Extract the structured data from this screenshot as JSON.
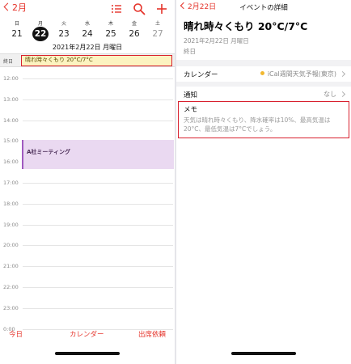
{
  "left": {
    "back_label": "2月",
    "weekdays": [
      "日",
      "月",
      "火",
      "水",
      "木",
      "金",
      "土"
    ],
    "dates": [
      {
        "label": "21",
        "state": "normal"
      },
      {
        "label": "22",
        "state": "selected"
      },
      {
        "label": "23",
        "state": "normal"
      },
      {
        "label": "24",
        "state": "normal"
      },
      {
        "label": "25",
        "state": "normal"
      },
      {
        "label": "26",
        "state": "normal"
      },
      {
        "label": "27",
        "state": "dim"
      }
    ],
    "full_date": "2021年2月22日 月曜日",
    "allday_label": "終日",
    "allday_event": "晴れ時々くもり 20°C/7°C",
    "hours": [
      "12:00",
      "13:00",
      "14:00",
      "15:00",
      "16:00",
      "17:00",
      "18:00",
      "19:00",
      "20:00",
      "21:00",
      "22:00",
      "23:00",
      "0:00"
    ],
    "meeting_title": "A社ミーティング",
    "tabs": {
      "today": "今日",
      "calendars": "カレンダー",
      "inbox": "出席依頼"
    },
    "icons": [
      "list-icon",
      "search-icon",
      "add-icon"
    ],
    "accent_color": "#e5332a"
  },
  "right": {
    "back_label": "2月22日",
    "nav_title": "イベントの詳細",
    "event_title": "晴れ時々くもり 20°C/7°C",
    "event_date": "2021年2月22日 月曜日",
    "event_allday": "終日",
    "calendar_label": "カレンダー",
    "calendar_value": "iCal週間天気予報(東京)",
    "calendar_color": "#f2b830",
    "alert_label": "通知",
    "alert_value": "なし",
    "memo_heading": "メモ",
    "memo_text": "天気は晴れ時々くもり、降水確率は10%、最高気温は20°C、最低気温は7°Cでしょう。"
  }
}
